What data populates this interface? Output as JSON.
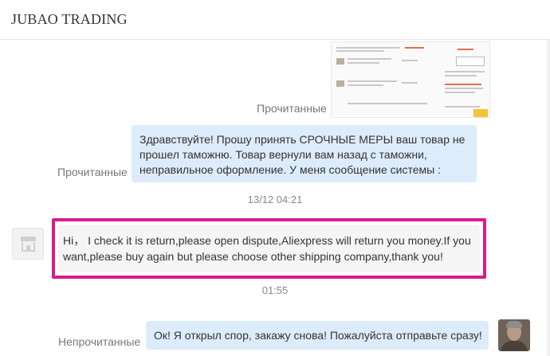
{
  "header": {
    "title": "JUBAO TRADING"
  },
  "messages": {
    "screenshot": {
      "status": "Прочитанные"
    },
    "outgoing_1": {
      "text": "Здравствуйте! Прошу принять СРОЧНЫЕ МЕРЫ ваш товар не прошел таможню. Товар вернули вам назад с таможни, неправильное оформление. У меня сообщение системы :",
      "status": "Прочитанные"
    },
    "timestamp_1": "13/12 04:21",
    "incoming_1": {
      "text": "Hi， I check it is return,please open dispute,Aliexpress will return you money.If you want,please buy again but please choose other shipping company,thank you!"
    },
    "timestamp_2": "01:55",
    "outgoing_2": {
      "text": "Ок! Я открыл спор, закажу снова! Пожалуйста отправьте сразу!",
      "status": "Непрочитанные"
    }
  },
  "colors": {
    "outgoing_bubble": "#ddecfb",
    "incoming_bubble": "#f5f5f5",
    "highlight_border": "#d81b8a"
  }
}
